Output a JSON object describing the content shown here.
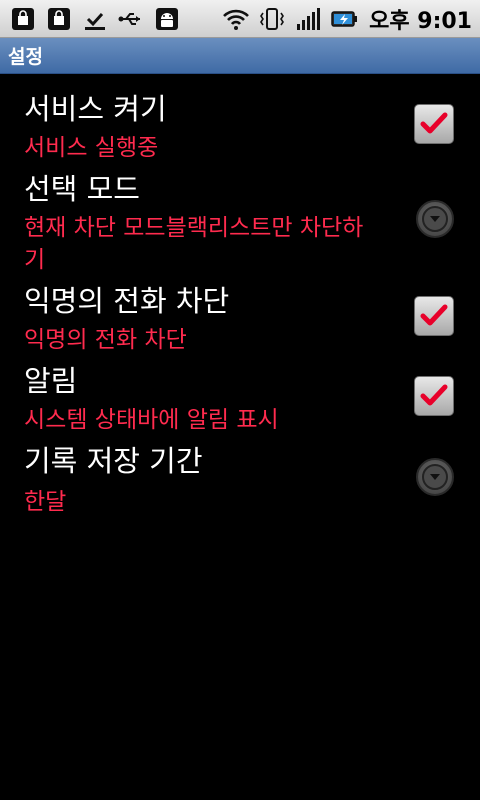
{
  "status_bar": {
    "icons_left": [
      "bag-icon",
      "bag-icon",
      "download-done-icon",
      "usb-icon",
      "android-icon"
    ],
    "icons_right": [
      "wifi-icon",
      "vibrate-icon",
      "signal-icon",
      "battery-charging-icon"
    ],
    "clock": "오후 9:01"
  },
  "title_bar": {
    "title": "설정"
  },
  "prefs": [
    {
      "title": "서비스 켜기",
      "summary": "서비스 실행중",
      "widget": "checkbox",
      "checked": true
    },
    {
      "title": "선택 모드",
      "summary": "현재 차단 모드블랙리스트만 차단하기",
      "widget": "dropdown"
    },
    {
      "title": "익명의 전화 차단",
      "summary": "익명의 전화 차단",
      "widget": "checkbox",
      "checked": true
    },
    {
      "title": "알림",
      "summary": "시스템 상태바에 알림 표시",
      "widget": "checkbox",
      "checked": true
    },
    {
      "title": "기록 저장 기간",
      "summary": "한달",
      "widget": "dropdown"
    }
  ],
  "colors": {
    "summary": "#ff2b4e",
    "title_bar": "#4f78ae",
    "check": "#e8002a"
  }
}
